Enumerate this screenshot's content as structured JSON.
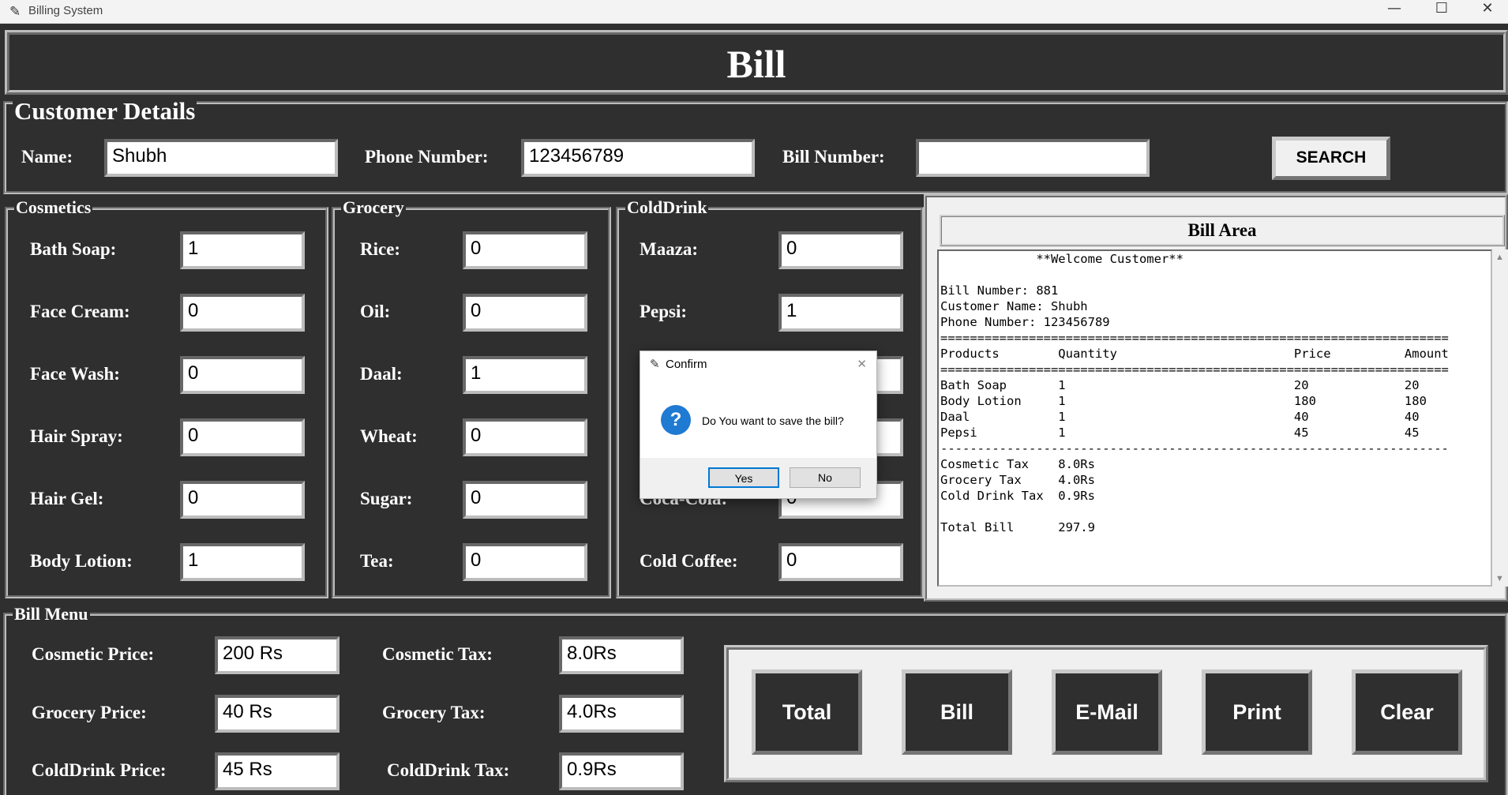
{
  "window": {
    "title": "Billing System",
    "minimize": "—",
    "maximize": "☐",
    "close": "✕"
  },
  "header": {
    "title": "Bill"
  },
  "customer": {
    "frame_title": "Customer Details",
    "name_label": "Name:",
    "name_value": "Shubh",
    "phone_label": "Phone Number:",
    "phone_value": "123456789",
    "bill_label": "Bill Number:",
    "bill_value": "",
    "search_label": "SEARCH"
  },
  "cosmetics": {
    "frame_title": "Cosmetics",
    "items": [
      {
        "label": "Bath Soap:",
        "value": "1"
      },
      {
        "label": "Face Cream:",
        "value": "0"
      },
      {
        "label": "Face Wash:",
        "value": "0"
      },
      {
        "label": "Hair Spray:",
        "value": "0"
      },
      {
        "label": "Hair Gel:",
        "value": "0"
      },
      {
        "label": "Body Lotion:",
        "value": "1"
      }
    ]
  },
  "grocery": {
    "frame_title": "Grocery",
    "items": [
      {
        "label": "Rice:",
        "value": "0"
      },
      {
        "label": "Oil:",
        "value": "0"
      },
      {
        "label": "Daal:",
        "value": "1"
      },
      {
        "label": "Wheat:",
        "value": "0"
      },
      {
        "label": "Sugar:",
        "value": "0"
      },
      {
        "label": "Tea:",
        "value": "0"
      }
    ]
  },
  "colddrink": {
    "frame_title": "ColdDrink",
    "items": [
      {
        "label": "Maaza:",
        "value": "0"
      },
      {
        "label": "Pepsi:",
        "value": "1"
      },
      {
        "label": "",
        "value": "0"
      },
      {
        "label": "",
        "value": "0"
      },
      {
        "label": "Coca-Cola:",
        "value": "0"
      },
      {
        "label": "Cold Coffee:",
        "value": "0"
      }
    ]
  },
  "bill_area": {
    "title": "Bill Area",
    "lines": [
      "             **Welcome Customer**",
      "",
      "Bill Number: 881",
      "Customer Name: Shubh",
      "Phone Number: 123456789",
      "=====================================================================",
      "Products        Quantity                        Price          Amount",
      "=====================================================================",
      "Bath Soap       1                               20             20",
      "Body Lotion     1                               180            180",
      "Daal            1                               40             40",
      "Pepsi           1                               45             45",
      "---------------------------------------------------------------------",
      "Cosmetic Tax    8.0Rs",
      "Grocery Tax     4.0Rs",
      "Cold Drink Tax  0.9Rs",
      "",
      "Total Bill      297.9"
    ]
  },
  "bill_menu": {
    "frame_title": "Bill Menu",
    "cosmetic_price_label": "Cosmetic Price:",
    "cosmetic_price": "200 Rs",
    "grocery_price_label": "Grocery Price:",
    "grocery_price": "40 Rs",
    "colddrink_price_label": "ColdDrink Price:",
    "colddrink_price": "45 Rs",
    "cosmetic_tax_label": "Cosmetic Tax:",
    "cosmetic_tax": "8.0Rs",
    "grocery_tax_label": "Grocery Tax:",
    "grocery_tax": "4.0Rs",
    "colddrink_tax_label": "ColdDrink Tax:",
    "colddrink_tax": "0.9Rs"
  },
  "actions": {
    "total": "Total",
    "bill": "Bill",
    "email": "E-Mail",
    "print": "Print",
    "clear": "Clear"
  },
  "dialog": {
    "title": "Confirm",
    "message": "Do You want to save the bill?",
    "yes": "Yes",
    "no": "No",
    "close": "✕",
    "icon": "question-icon"
  }
}
